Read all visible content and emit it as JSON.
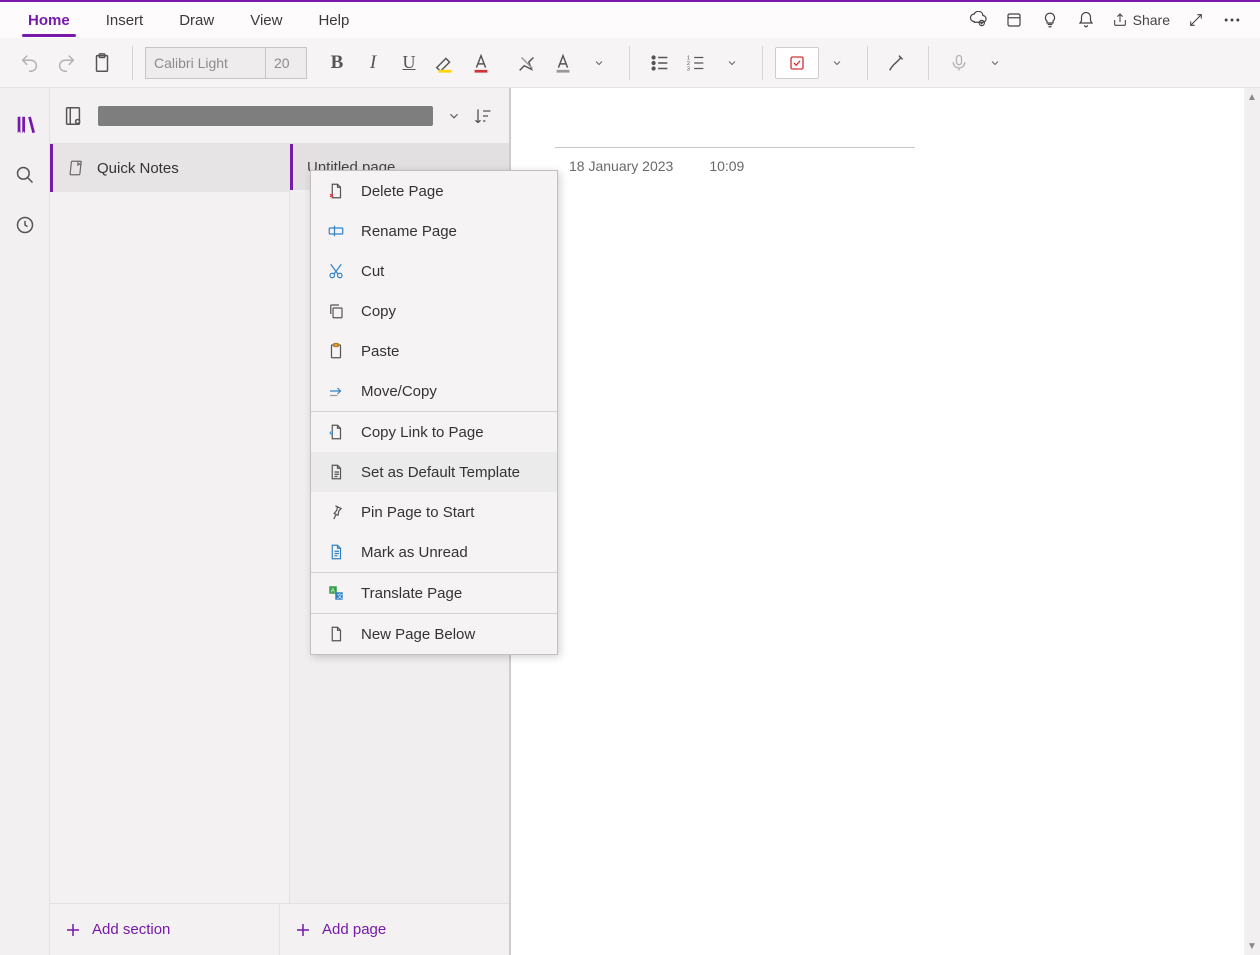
{
  "tabs": {
    "items": [
      "Home",
      "Insert",
      "Draw",
      "View",
      "Help"
    ],
    "active_index": 0
  },
  "titlebar": {
    "share": "Share"
  },
  "ribbon": {
    "font_name": "Calibri Light",
    "font_size": "20"
  },
  "sidebar": {
    "notebook_name_redacted": true
  },
  "sections": {
    "items": [
      "Quick Notes"
    ],
    "add_label": "Add section"
  },
  "pages": {
    "items": [
      "Untitled page"
    ],
    "add_label": "Add page"
  },
  "page": {
    "date": "18 January 2023",
    "time": "10:09"
  },
  "context_menu": {
    "items": [
      "Delete Page",
      "Rename Page",
      "Cut",
      "Copy",
      "Paste",
      "Move/Copy",
      "Copy Link to Page",
      "Set as Default Template",
      "Pin Page to Start",
      "Mark as Unread",
      "Translate Page",
      "New Page Below"
    ],
    "highlight_index": 7
  }
}
